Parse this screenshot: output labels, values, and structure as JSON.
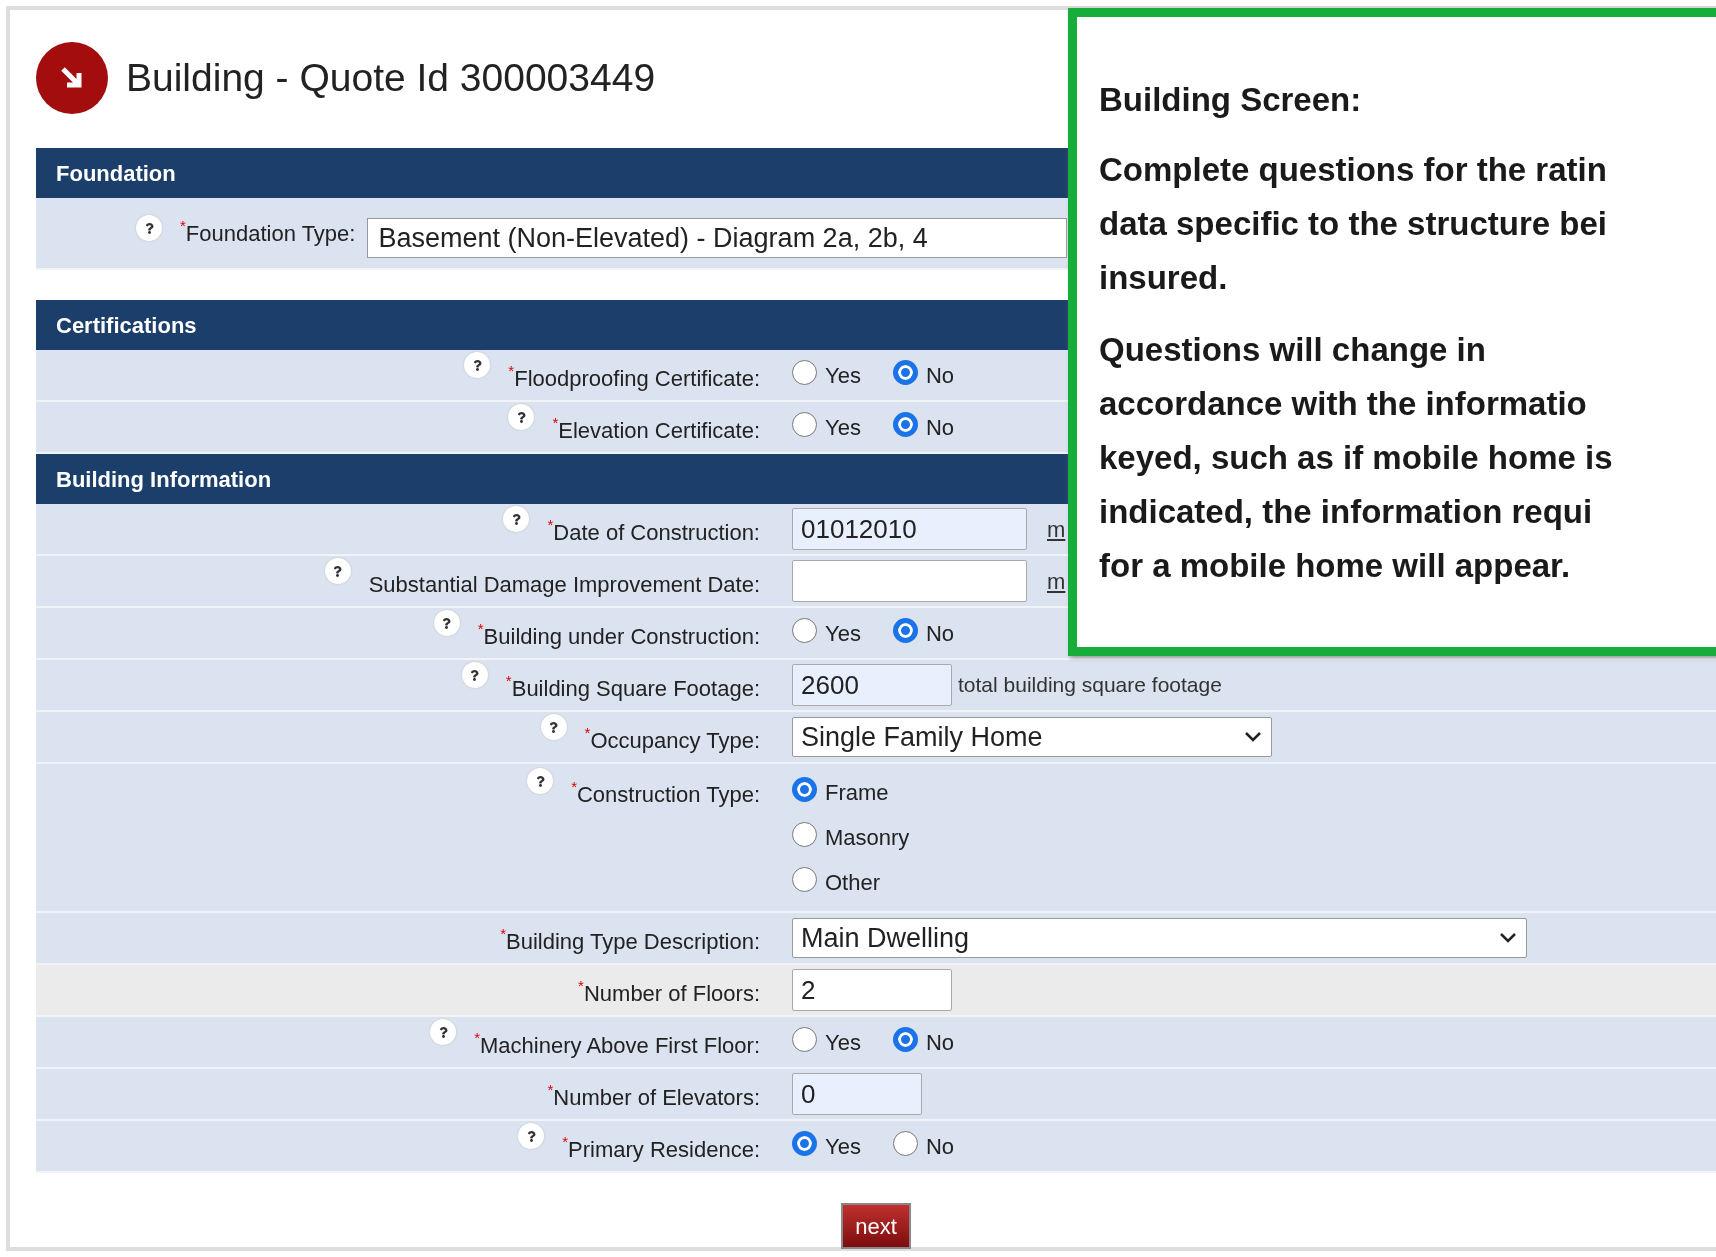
{
  "title": "Building - Quote Id 300003449",
  "sections": [
    {
      "title": "Foundation",
      "rows": [
        {
          "kind": "select-left",
          "help": true,
          "required_mark": "*",
          "highlighted": false,
          "label": "Foundation Type:",
          "value": "Basement (Non-Elevated) - Diagram 2a, 2b, 4"
        }
      ]
    },
    {
      "title": "Certifications",
      "rows": [
        {
          "kind": "radio",
          "help": true,
          "required_mark": "*",
          "highlighted": false,
          "label": "Floodproofing Certificate:",
          "options": [
            {
              "label": "Yes",
              "selected": false
            },
            {
              "label": "No",
              "selected": true
            }
          ]
        },
        {
          "kind": "radio",
          "help": true,
          "required_mark": "*",
          "highlighted": false,
          "label": "Elevation Certificate:",
          "options": [
            {
              "label": "Yes",
              "selected": false
            },
            {
              "label": "No",
              "selected": true
            }
          ]
        }
      ]
    },
    {
      "title": "Building Information",
      "rows": [
        {
          "kind": "date",
          "help": true,
          "required_mark": "*",
          "highlighted": false,
          "label": "Date of Construction:",
          "value": "01012010",
          "filled": true,
          "hint": "m"
        },
        {
          "kind": "date",
          "help": true,
          "highlighted": false,
          "label": "Substantial Damage Improvement Date:",
          "filled": false,
          "hint": "m"
        },
        {
          "kind": "radio",
          "help": true,
          "required_mark": "*",
          "highlighted": false,
          "label": "Building under Construction:",
          "options": [
            {
              "label": "Yes",
              "selected": false
            },
            {
              "label": "No",
              "selected": true
            }
          ]
        },
        {
          "kind": "number",
          "help": true,
          "required_mark": "*",
          "highlighted": false,
          "label": "Building Square Footage:",
          "value": "2600",
          "filled": true,
          "note": "total building square footage"
        },
        {
          "kind": "select",
          "help": true,
          "required_mark": "*",
          "highlighted": false,
          "label": "Occupancy Type:",
          "value": "Single Family Home"
        },
        {
          "kind": "radio-stacked",
          "help": true,
          "required_mark": "*",
          "highlighted": false,
          "label": "Construction Type:",
          "options": [
            {
              "label": "Frame",
              "selected": true
            },
            {
              "label": "Masonry",
              "selected": false
            },
            {
              "label": "Other",
              "selected": false
            }
          ]
        },
        {
          "kind": "select-wide",
          "help": false,
          "required_mark": "*",
          "highlighted": false,
          "label": "Building Type Description:",
          "value": "Main Dwelling"
        },
        {
          "kind": "number",
          "help": false,
          "required_mark": "*",
          "highlighted": true,
          "label": "Number of Floors:",
          "value": "2",
          "filled": false
        },
        {
          "kind": "radio",
          "help": true,
          "required_mark": "*",
          "highlighted": false,
          "label": "Machinery Above First Floor:",
          "options": [
            {
              "label": "Yes",
              "selected": false
            },
            {
              "label": "No",
              "selected": true
            }
          ]
        },
        {
          "kind": "number-small",
          "help": false,
          "required_mark": "*",
          "highlighted": false,
          "label": "Number of Elevators:",
          "value": "0",
          "filled": true
        },
        {
          "kind": "radio",
          "help": true,
          "required_mark": "*",
          "highlighted": false,
          "label": "Primary Residence:",
          "options": [
            {
              "label": "Yes",
              "selected": true
            },
            {
              "label": "No",
              "selected": false
            }
          ]
        }
      ]
    }
  ],
  "next_button": "next",
  "callout": {
    "heading": "Building Screen:",
    "paragraphs": [
      [
        "Complete questions for the ratin",
        "data specific to the structure bei",
        "insured."
      ],
      [
        "Questions will change in",
        "accordance with the informatio",
        "keyed, such as if mobile home is",
        "indicated, the information requi",
        "for a mobile home will appear."
      ]
    ]
  }
}
